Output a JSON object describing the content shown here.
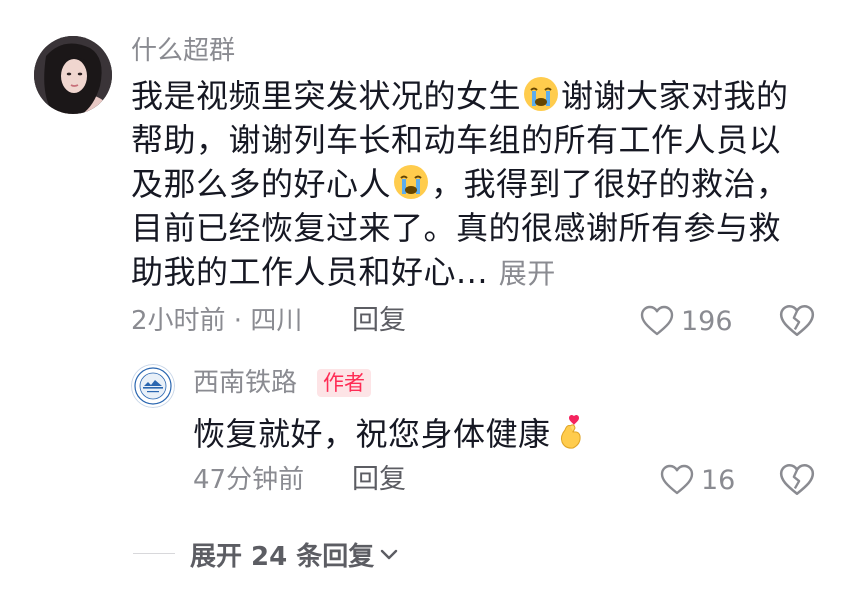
{
  "comment": {
    "username": "什么超群",
    "text_parts": [
      "我是视频里突发状况的女生",
      "谢谢大家对我的帮助，谢谢列车长和动车组的所有工作人员以及那么多的好心人",
      "，我得到了很好的救治，目前已经恢复过来了。真的很感谢所有参与救助我的工作人员和好心..."
    ],
    "expand_label": "展开",
    "time_location": "2小时前 · 四川",
    "reply_label": "回复",
    "like_count": "196",
    "emoji": "crying-face"
  },
  "reply": {
    "username": "西南铁路",
    "badge": "作者",
    "text": "恢复就好，祝您身体健康",
    "emoji": "finger-heart",
    "time": "47分钟前",
    "reply_label": "回复",
    "like_count": "16"
  },
  "more_replies": {
    "label": "展开 24 条回复"
  },
  "colors": {
    "primary_text": "#161823",
    "secondary_text": "#8a8b91",
    "author_badge": "#fe2c55",
    "author_badge_bg": "#fde4e6"
  }
}
